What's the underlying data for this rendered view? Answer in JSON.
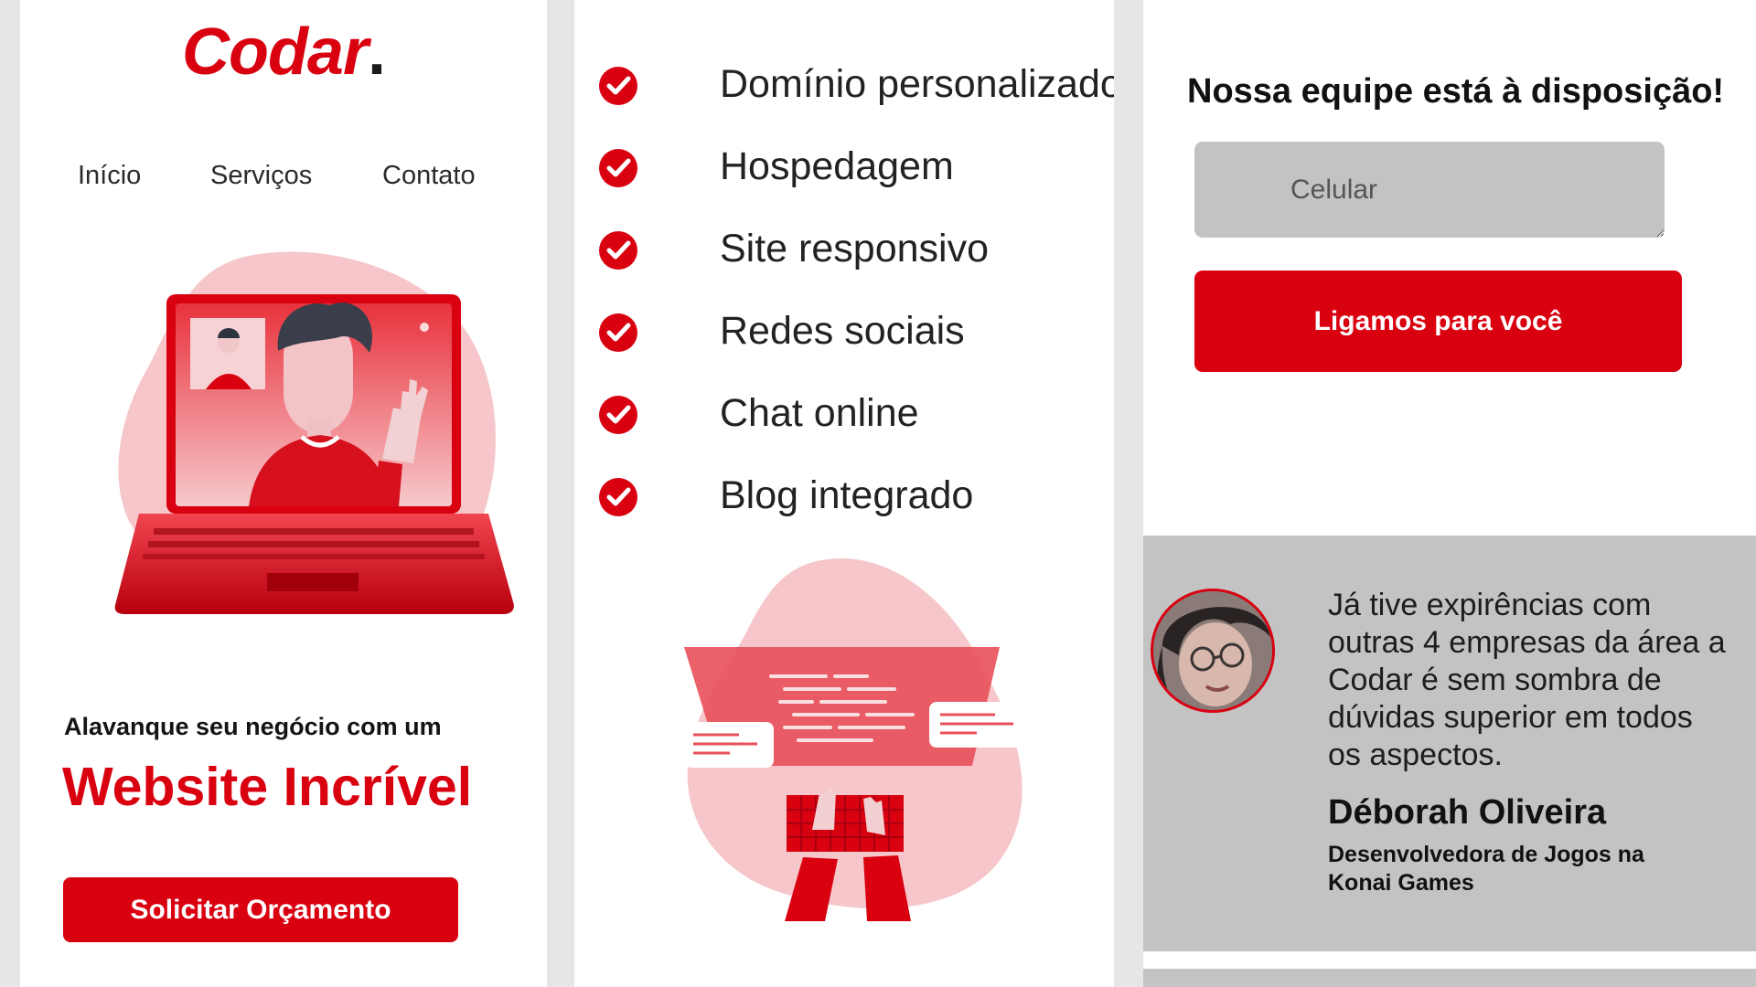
{
  "brand": {
    "name": "Codar",
    "dot": ".",
    "accent": "#d90010",
    "panel_gray": "#c3c3c3",
    "page_bg": "#e7e5e5"
  },
  "nav": {
    "items": [
      {
        "label": "Início"
      },
      {
        "label": "Serviços"
      },
      {
        "label": "Contato"
      }
    ]
  },
  "hero": {
    "illustration": "laptop-video-call-illustration",
    "tagline": "Alavanque seu negócio com um",
    "headline": "Website Incrível",
    "cta_label": "Solicitar Orçamento"
  },
  "features": {
    "icon": "check-circle-icon",
    "items": [
      {
        "label": "Domínio personalizado"
      },
      {
        "label": "Hospedagem"
      },
      {
        "label": "Site responsivo"
      },
      {
        "label": "Redes sociais"
      },
      {
        "label": "Chat online"
      },
      {
        "label": "Blog integrado"
      }
    ],
    "illustration": "developer-coding-illustration"
  },
  "contact": {
    "title": "Nossa equipe está à disposição!",
    "phone_placeholder": "Celular",
    "submit_label": "Ligamos para você"
  },
  "testimonial": {
    "quote": "Já tive expirências com outras 4 empresas da área a Codar é sem sombra de dúvidas superior em todos os aspectos.",
    "author": "Déborah Oliveira",
    "role": "Desenvolvedora de Jogos na Konai Games"
  }
}
